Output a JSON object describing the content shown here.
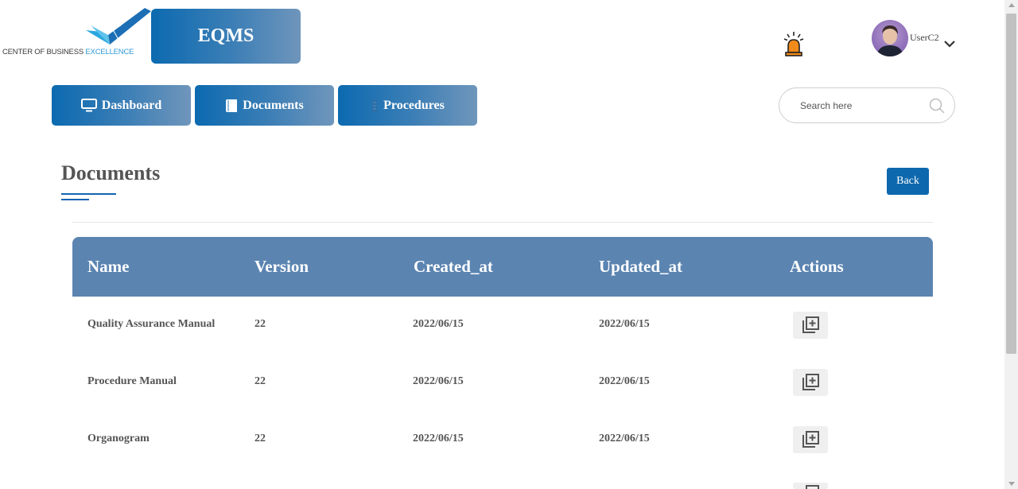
{
  "brand": {
    "logo_text_main": "CENTER OF BUSINESS ",
    "logo_text_accent": "EXCELLENCE",
    "app_name": "EQMS"
  },
  "header": {
    "alarm_icon": "alarm-siren-icon",
    "username": "UserC2",
    "menu_icon": "chevron-down-icon"
  },
  "nav": {
    "items": [
      {
        "label": "Dashboard",
        "icon": "monitor-icon"
      },
      {
        "label": "Documents",
        "icon": "book-icon"
      },
      {
        "label": "Procedures",
        "icon": "procedures-icon"
      }
    ]
  },
  "search": {
    "placeholder": "Search here",
    "value": ""
  },
  "page": {
    "title": "Documents",
    "back_label": "Back"
  },
  "table": {
    "headers": [
      "Name",
      "Version",
      "Created_at",
      "Updated_at",
      "Actions"
    ],
    "rows": [
      {
        "name": "Quality Assurance Manual",
        "version": "22",
        "created_at": "2022/06/15",
        "updated_at": "2022/06/15"
      },
      {
        "name": "Procedure Manual",
        "version": "22",
        "created_at": "2022/06/15",
        "updated_at": "2022/06/15"
      },
      {
        "name": "Organogram",
        "version": "22",
        "created_at": "2022/06/15",
        "updated_at": "2022/06/15"
      }
    ]
  },
  "colors": {
    "brand_blue": "#0e68ad",
    "table_header": "#5b84b1",
    "alarm_orange": "#f08a1a"
  }
}
